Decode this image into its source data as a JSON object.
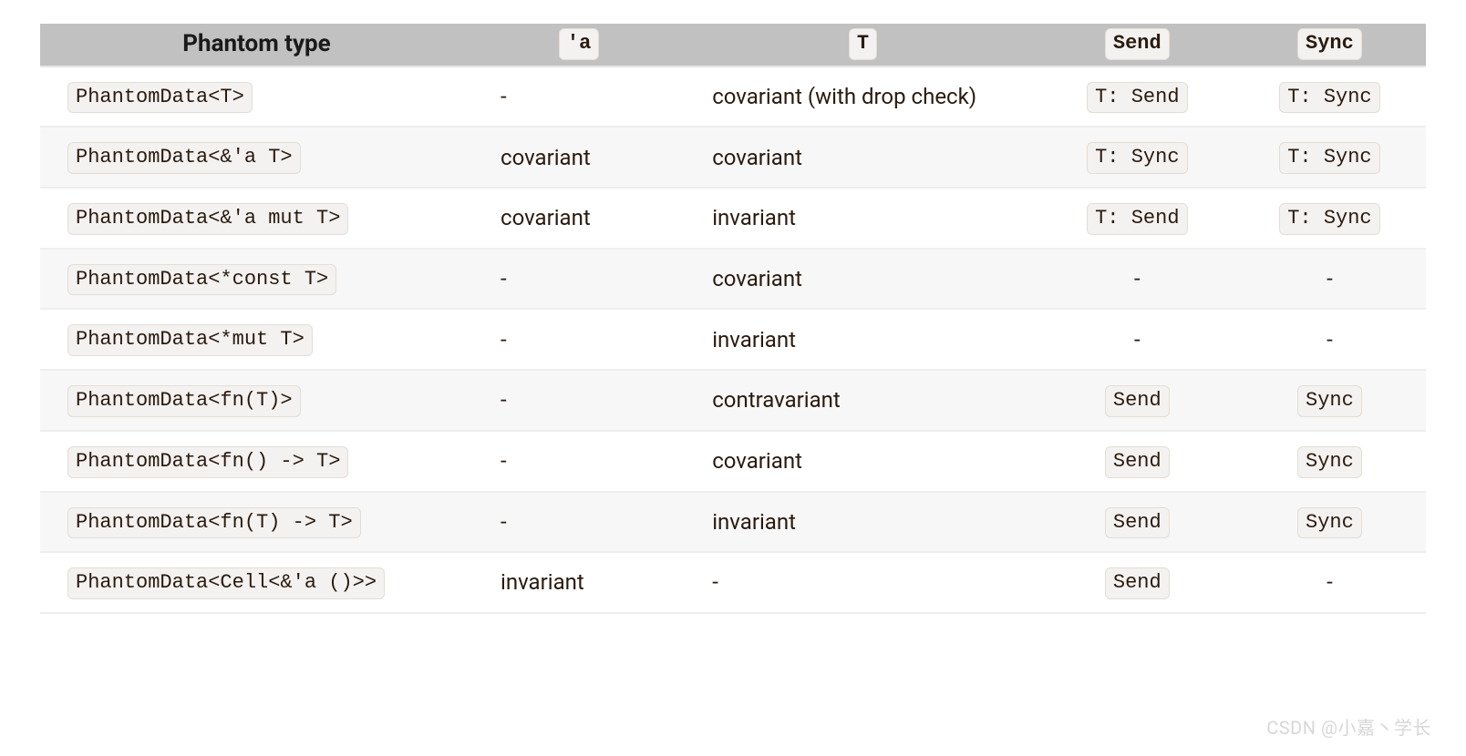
{
  "table": {
    "headers": {
      "phantom": "Phantom type",
      "lifetime": "'a",
      "t": "T",
      "send": "Send",
      "sync": "Sync"
    },
    "rows": [
      {
        "type_code": "PhantomData<T>",
        "lifetime_text": "-",
        "t_text": "covariant (with drop check)",
        "send_code": "T: Send",
        "sync_code": "T: Sync"
      },
      {
        "type_code": "PhantomData<&'a T>",
        "lifetime_text": "covariant",
        "t_text": "covariant",
        "send_code": "T: Sync",
        "sync_code": "T: Sync"
      },
      {
        "type_code": "PhantomData<&'a mut T>",
        "lifetime_text": "covariant",
        "t_text": "invariant",
        "send_code": "T: Send",
        "sync_code": "T: Sync"
      },
      {
        "type_code": "PhantomData<*const T>",
        "lifetime_text": "-",
        "t_text": "covariant",
        "send_text": "-",
        "sync_text": "-"
      },
      {
        "type_code": "PhantomData<*mut T>",
        "lifetime_text": "-",
        "t_text": "invariant",
        "send_text": "-",
        "sync_text": "-"
      },
      {
        "type_code": "PhantomData<fn(T)>",
        "lifetime_text": "-",
        "t_text": "contravariant",
        "send_code": "Send",
        "sync_code": "Sync"
      },
      {
        "type_code": "PhantomData<fn() -> T>",
        "lifetime_text": "-",
        "t_text": "covariant",
        "send_code": "Send",
        "sync_code": "Sync"
      },
      {
        "type_code": "PhantomData<fn(T) -> T>",
        "lifetime_text": "-",
        "t_text": "invariant",
        "send_code": "Send",
        "sync_code": "Sync"
      },
      {
        "type_code": "PhantomData<Cell<&'a ()>>",
        "lifetime_text": "invariant",
        "t_text": "-",
        "send_code": "Send",
        "sync_text": "-"
      }
    ]
  },
  "watermark": "CSDN @小嘉丶学长"
}
